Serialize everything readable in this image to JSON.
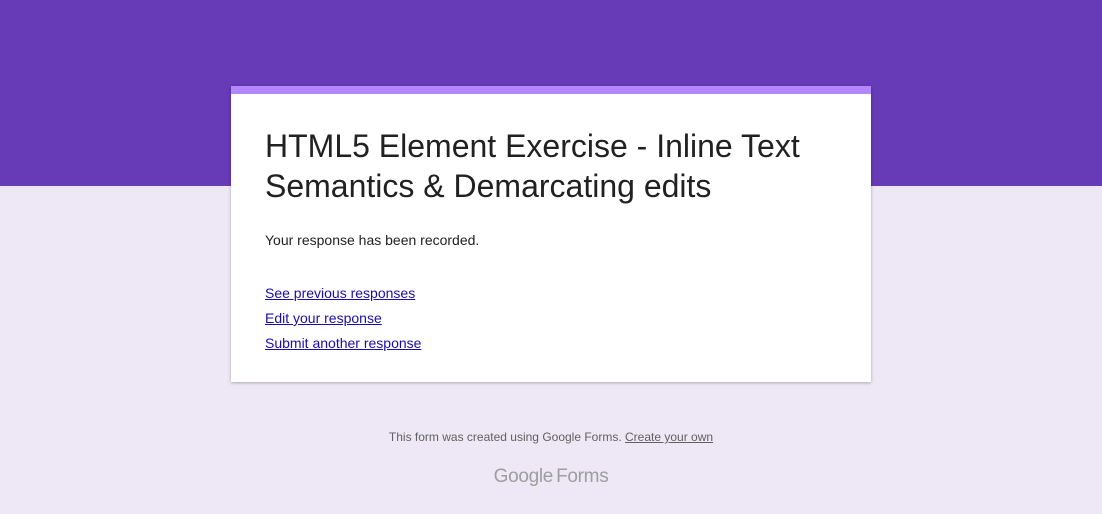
{
  "header": {
    "band_color": "#673ab7",
    "background_color": "#ede7f6",
    "accent_color": "#b388ff"
  },
  "card": {
    "title": "HTML5 Element Exercise - Inline Text Semantics & Demarcating edits",
    "confirmation": "Your response has been recorded.",
    "links": {
      "see_previous": "See previous responses",
      "edit_response": "Edit your response",
      "submit_another": "Submit another response"
    },
    "link_color": "#1a0dab"
  },
  "footer": {
    "text": "This form was created using Google Forms.",
    "create_link": "Create your own",
    "brand_google": "Google",
    "brand_forms": "Forms"
  }
}
